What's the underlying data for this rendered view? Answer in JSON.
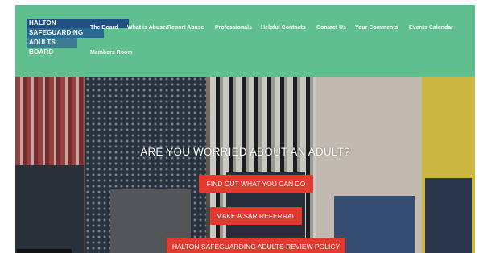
{
  "logo": {
    "lines": [
      "HALTON",
      "SAFEGUARDING",
      "ADULTS",
      "BOARD"
    ],
    "colors": [
      "#1f4f86",
      "#2a6a8f",
      "#3c7d95",
      "#5fbf8e"
    ]
  },
  "nav": {
    "items": [
      "The Board",
      "What is Abuse/Report Abuse",
      "Professionals",
      "Helpful Contacts",
      "Contact Us",
      "Your Comments",
      "Events Calendar",
      "Members Room"
    ]
  },
  "hero": {
    "title": "ARE YOU WORRIED ABOUT AN ADULT?",
    "buttons": [
      "FIND OUT WHAT YOU CAN DO",
      "MAKE A SAR REFERRAL",
      "HALTON SAFEGUARDING ADULTS REVIEW POLICY"
    ]
  },
  "colors": {
    "header_bg": "#5fbf8e",
    "cta_bg": "#e23a2f",
    "text": "#ffffff"
  }
}
